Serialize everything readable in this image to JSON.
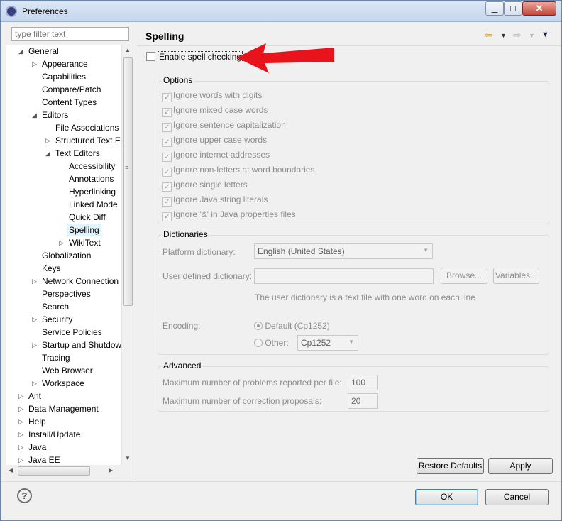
{
  "window": {
    "title": "Preferences"
  },
  "filter": {
    "placeholder": "type filter text"
  },
  "tree": [
    {
      "label": "General",
      "twisty": "open"
    },
    {
      "label": "Appearance",
      "twisty": "closed"
    },
    {
      "label": "Capabilities",
      "twisty": ""
    },
    {
      "label": "Compare/Patch",
      "twisty": ""
    },
    {
      "label": "Content Types",
      "twisty": ""
    },
    {
      "label": "Editors",
      "twisty": "open"
    },
    {
      "label": "File Associations",
      "twisty": ""
    },
    {
      "label": "Structured Text E",
      "twisty": "closed"
    },
    {
      "label": "Text Editors",
      "twisty": "open"
    },
    {
      "label": "Accessibility",
      "twisty": ""
    },
    {
      "label": "Annotations",
      "twisty": ""
    },
    {
      "label": "Hyperlinking",
      "twisty": ""
    },
    {
      "label": "Linked Mode",
      "twisty": ""
    },
    {
      "label": "Quick Diff",
      "twisty": ""
    },
    {
      "label": "Spelling",
      "twisty": "",
      "selected": true
    },
    {
      "label": "WikiText",
      "twisty": "closed"
    },
    {
      "label": "Globalization",
      "twisty": ""
    },
    {
      "label": "Keys",
      "twisty": ""
    },
    {
      "label": "Network Connection",
      "twisty": "closed"
    },
    {
      "label": "Perspectives",
      "twisty": ""
    },
    {
      "label": "Search",
      "twisty": ""
    },
    {
      "label": "Security",
      "twisty": "closed"
    },
    {
      "label": "Service Policies",
      "twisty": ""
    },
    {
      "label": "Startup and Shutdow",
      "twisty": "closed"
    },
    {
      "label": "Tracing",
      "twisty": ""
    },
    {
      "label": "Web Browser",
      "twisty": ""
    },
    {
      "label": "Workspace",
      "twisty": "closed"
    },
    {
      "label": "Ant",
      "twisty": "closed"
    },
    {
      "label": "Data Management",
      "twisty": "closed"
    },
    {
      "label": "Help",
      "twisty": "closed"
    },
    {
      "label": "Install/Update",
      "twisty": "closed"
    },
    {
      "label": "Java",
      "twisty": "closed"
    },
    {
      "label": "Java EE",
      "twisty": "closed"
    }
  ],
  "page": {
    "title": "Spelling"
  },
  "enable_spell": {
    "label": "Enable spell checking",
    "checked": false
  },
  "options": {
    "title": "Options",
    "items": [
      "Ignore words with digits",
      "Ignore mixed case words",
      "Ignore sentence capitalization",
      "Ignore upper case words",
      "Ignore internet addresses",
      "Ignore non-letters at word boundaries",
      "Ignore single letters",
      "Ignore Java string literals",
      "Ignore '&' in Java properties files"
    ]
  },
  "dictionaries": {
    "title": "Dictionaries",
    "platform_label": "Platform dictionary:",
    "platform_value": "English (United States)",
    "user_label": "User defined dictionary:",
    "user_value": "",
    "browse": "Browse...",
    "variables": "Variables...",
    "hint": "The user dictionary is a text file with one word on each line",
    "encoding_label": "Encoding:",
    "default_label": "Default (Cp1252)",
    "other_label": "Other:",
    "other_value": "Cp1252"
  },
  "advanced": {
    "title": "Advanced",
    "max_problems_label": "Maximum number of problems reported per file:",
    "max_problems_value": "100",
    "max_proposals_label": "Maximum number of correction proposals:",
    "max_proposals_value": "20"
  },
  "buttons": {
    "restore": "Restore Defaults",
    "apply": "Apply",
    "ok": "OK",
    "cancel": "Cancel"
  },
  "colors": {
    "annotation_arrow": "#e8131b",
    "selection": "#e5f3fb"
  }
}
